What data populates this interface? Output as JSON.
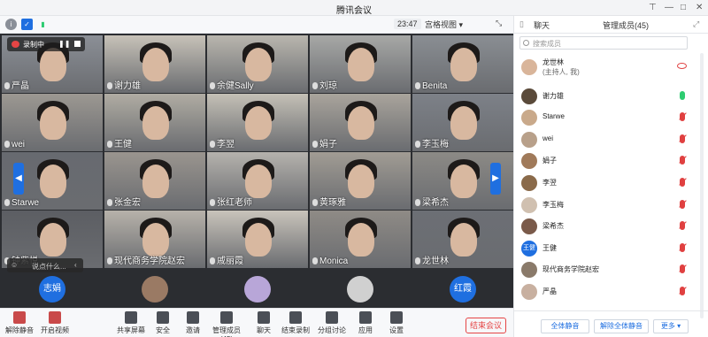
{
  "window": {
    "title": "腾讯会议"
  },
  "topbar": {
    "timer": "23:47",
    "view_label": "宫格视图 ▾"
  },
  "recording": {
    "label": "录制中"
  },
  "tiles": [
    {
      "name": "严晶"
    },
    {
      "name": "谢力雄"
    },
    {
      "name": "余健Sally"
    },
    {
      "name": "刘琼"
    },
    {
      "name": "Benita"
    },
    {
      "name": "wei"
    },
    {
      "name": "王健"
    },
    {
      "name": "李翌"
    },
    {
      "name": "娟子"
    },
    {
      "name": "李玉梅"
    },
    {
      "name": "Starwe"
    },
    {
      "name": "张金宏"
    },
    {
      "name": "张红老师"
    },
    {
      "name": "黄琢雅"
    },
    {
      "name": "梁希杰"
    },
    {
      "name": "钟紫悦"
    },
    {
      "name": "现代商务学院赵宏"
    },
    {
      "name": "戚丽霞"
    },
    {
      "name": "Monica"
    },
    {
      "name": "龙世林"
    }
  ],
  "chat_placeholder": "说点什么...",
  "strip": [
    {
      "label": "志娟"
    },
    {
      "label": ""
    },
    {
      "label": ""
    },
    {
      "label": ""
    },
    {
      "label": "红霞"
    }
  ],
  "bottombar": {
    "items": [
      "解除静音",
      "开启视频",
      "共享屏幕",
      "安全",
      "邀请",
      "管理成员(45)",
      "聊天",
      "结束录制",
      "分组讨论",
      "应用",
      "设置"
    ],
    "end_label": "结束会议"
  },
  "panel": {
    "tab_chat": "聊天",
    "tab_members": "管理成员(45)",
    "search_placeholder": "搜索成员",
    "members": [
      {
        "name": "龙世林",
        "sub": "(主持人, 我)",
        "avatar": ""
      },
      {
        "name": "谢力雄",
        "avatar": ""
      },
      {
        "name": "Starwe",
        "avatar": ""
      },
      {
        "name": "wei",
        "avatar": ""
      },
      {
        "name": "娟子",
        "avatar": ""
      },
      {
        "name": "李翌",
        "avatar": ""
      },
      {
        "name": "李玉梅",
        "avatar": ""
      },
      {
        "name": "梁希杰",
        "avatar": ""
      },
      {
        "name": "王健",
        "avatar": "王健"
      },
      {
        "name": "现代商务学院赵宏",
        "avatar": ""
      },
      {
        "name": "严晶",
        "avatar": ""
      }
    ],
    "mute_all": "全体静音",
    "unmute_all": "解除全体静音",
    "more": "更多 ▾"
  },
  "colors": {
    "accent": "#1f6fe0",
    "danger": "#e54545",
    "grid_bg": "#2b2d31"
  }
}
